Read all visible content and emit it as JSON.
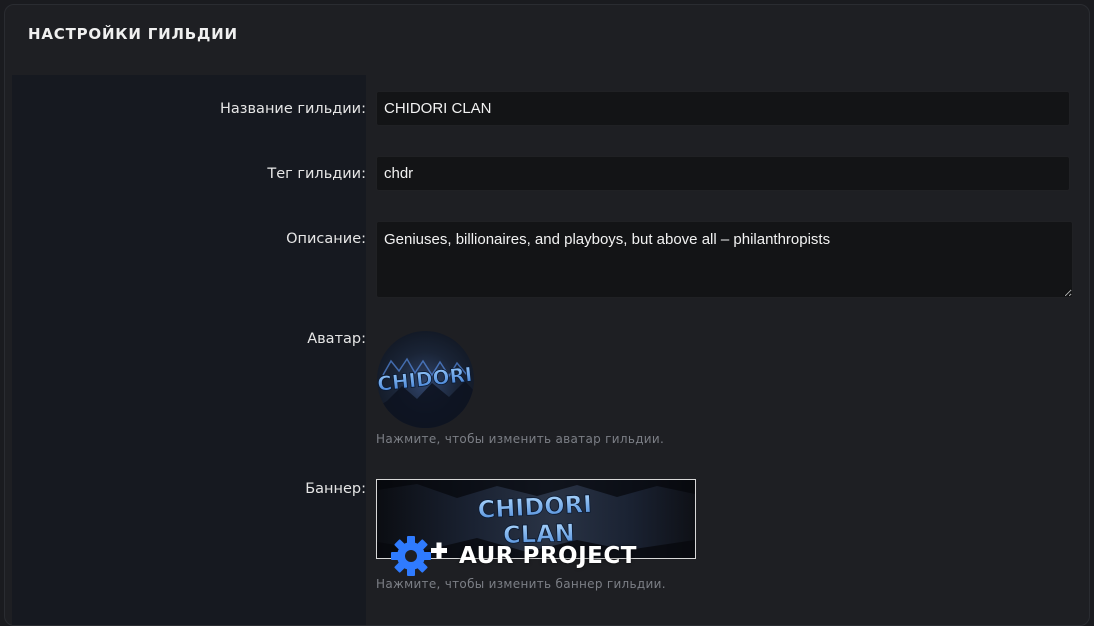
{
  "header": {
    "title": "Настройки гильдии"
  },
  "form": {
    "name_label": "Название гильдии:",
    "name_value": "CHIDORI CLAN",
    "tag_label": "Тег гильдии:",
    "tag_value": "chdr",
    "description_label": "Описание:",
    "description_value": "Geniuses, billionaires, and playboys, but above all – philanthropists",
    "avatar_label": "Аватар:",
    "avatar_hint": "Нажмите, чтобы изменить аватар гильдии.",
    "banner_label": "Баннер:",
    "banner_hint": "Нажмите, чтобы изменить баннер гильдии."
  },
  "images": {
    "avatar_logo_text": "CHIDORI",
    "banner_logo_line1": "CHIDORI",
    "banner_logo_line2": "CLAN"
  },
  "watermark": {
    "text": "AUR PROJECT",
    "icon": "gear-plus-icon"
  },
  "colors": {
    "page_bg": "#1a1b1f",
    "panel_bg": "#1e1f23",
    "label_column_bg": "#161920",
    "input_bg": "#131416",
    "hint_text": "#7c7f86",
    "logo_blue": "#6aa8ff",
    "watermark_blue": "#2f7bff"
  }
}
